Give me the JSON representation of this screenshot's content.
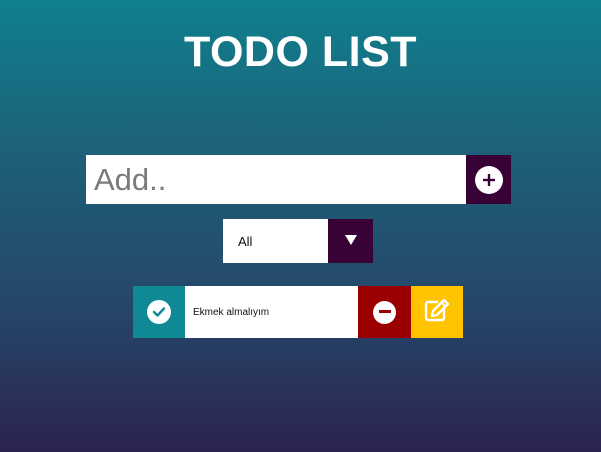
{
  "header": {
    "title": "TODO LIST"
  },
  "add_form": {
    "placeholder": "Add..",
    "value": "",
    "button_icon": "plus-circle-icon"
  },
  "filter": {
    "selected": "All",
    "arrow_icon": "caret-down-icon"
  },
  "todos": [
    {
      "text": "Ekmek almalıyım",
      "check_icon": "check-circle-icon",
      "remove_icon": "minus-circle-icon",
      "edit_icon": "edit-icon"
    }
  ],
  "colors": {
    "gradient_top": "#0f808d",
    "gradient_bottom": "#2b2350",
    "accent_dark": "#380237",
    "check": "#0f8a94",
    "remove": "#9a0000",
    "edit": "#ffc300"
  }
}
